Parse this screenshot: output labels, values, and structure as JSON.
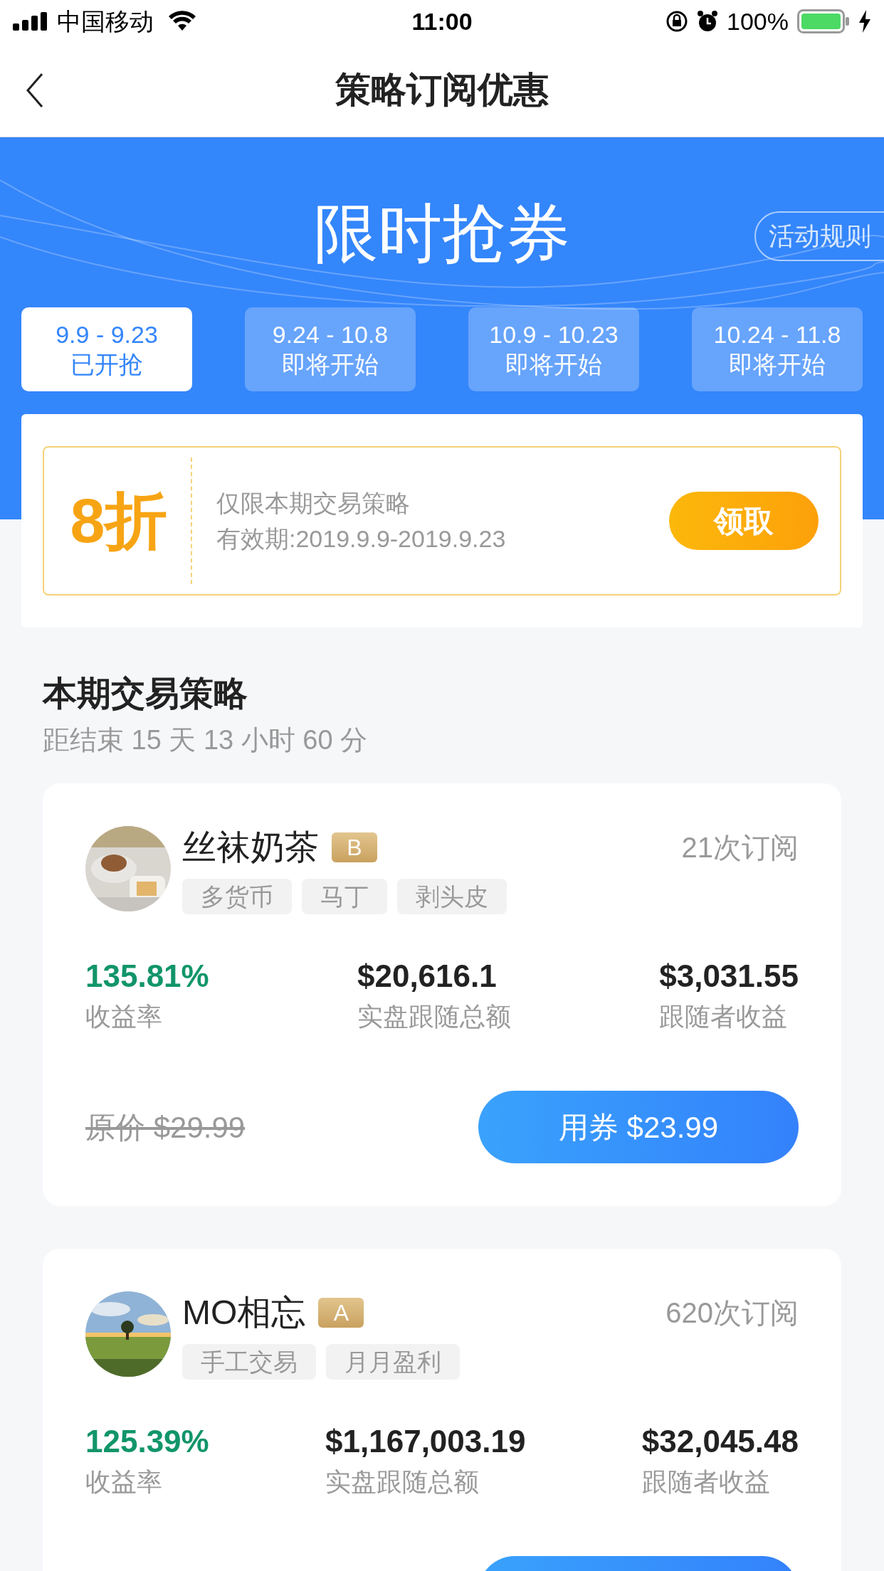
{
  "status_bar": {
    "carrier": "中国移动",
    "time": "11:00",
    "battery": "100%"
  },
  "header": {
    "title": "策略订阅优惠"
  },
  "hero": {
    "title": "限时抢券",
    "rules_button": "活动规则"
  },
  "periods": [
    {
      "dates": "9.9 - 9.23",
      "status": "已开抢",
      "selected": true
    },
    {
      "dates": "9.24 - 10.8",
      "status": "即将开始",
      "selected": false
    },
    {
      "dates": "10.9 - 10.23",
      "status": "即将开始",
      "selected": false
    },
    {
      "dates": "10.24 - 11.8",
      "status": "即将开始",
      "selected": false
    }
  ],
  "coupon": {
    "discount": "8折",
    "scope": "仅限本期交易策略",
    "validity": "有效期:2019.9.9-2019.9.23",
    "button": "领取"
  },
  "section": {
    "title": "本期交易策略",
    "countdown": "距结束 15 天 13 小时 60 分"
  },
  "strategies": [
    {
      "name": "丝袜奶茶",
      "grade": "B",
      "subscriptions": "21次订阅",
      "tags": [
        "多货币",
        "马丁",
        "剥头皮"
      ],
      "avatar": {
        "kind": "picture"
      },
      "stats": [
        {
          "value": "135.81%",
          "label": "收益率",
          "kind": "rate"
        },
        {
          "value": "$20,616.1",
          "label": "实盘跟随总额",
          "kind": "amount"
        },
        {
          "value": "$3,031.55",
          "label": "跟随者收益",
          "kind": "amount"
        }
      ],
      "original_price": "原价 $29.99",
      "button": "用券 $23.99"
    },
    {
      "name": "MO相忘",
      "grade": "A",
      "subscriptions": "620次订阅",
      "tags": [
        "手工交易",
        "月月盈利"
      ],
      "avatar": {
        "kind": "picture"
      },
      "stats": [
        {
          "value": "125.39%",
          "label": "收益率",
          "kind": "rate"
        },
        {
          "value": "$1,167,003.19",
          "label": "实盘跟随总额",
          "kind": "amount"
        },
        {
          "value": "$32,045.48",
          "label": "跟随者收益",
          "kind": "amount"
        }
      ]
    }
  ]
}
